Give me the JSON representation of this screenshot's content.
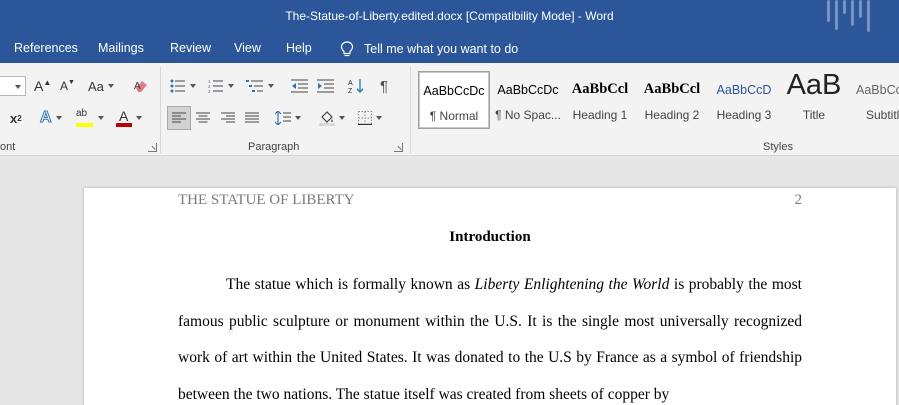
{
  "window": {
    "title": "The-Statue-of-Liberty.edited.docx [Compatibility Mode]  -  Word"
  },
  "tabs": [
    {
      "label": "References"
    },
    {
      "label": "Mailings"
    },
    {
      "label": "Review"
    },
    {
      "label": "View"
    },
    {
      "label": "Help"
    }
  ],
  "tell_me": {
    "label": "Tell me what you want to do"
  },
  "ribbon": {
    "groups": {
      "font": "ont",
      "paragraph": "Paragraph",
      "styles": "Styles"
    },
    "font": {
      "grow_font": "A",
      "shrink_font": "A",
      "change_case": "Aa",
      "superscript": "x",
      "superscript_mark": "2",
      "font_color_letter": "A",
      "highlight_letters": "ab",
      "text_effects_letter": "A"
    },
    "styles": [
      {
        "preview": "AaBbCcDc",
        "name": "¶ Normal",
        "selected": true
      },
      {
        "preview": "AaBbCcDc",
        "name": "¶ No Spac..."
      },
      {
        "preview": "AaBbCcl",
        "name": "Heading 1"
      },
      {
        "preview": "AaBbCcl",
        "name": "Heading 2"
      },
      {
        "preview": "AaBbCcD",
        "name": "Heading 3"
      },
      {
        "preview": "AaB",
        "name": "Title"
      },
      {
        "preview": "AaBbCc",
        "name": "Subtitle"
      }
    ]
  },
  "colors": {
    "ribbon_blue": "#2b579a",
    "font_color_underline": "#c00000",
    "highlight_underline": "#ffff00",
    "heading_blue": "#2f5496"
  },
  "document": {
    "running_head": "THE STATUE OF LIBERTY",
    "page_number": "2",
    "heading": "Introduction",
    "paragraph_part1": "The statue which is formally known as ",
    "paragraph_italic": "Liberty Enlightening the World",
    "paragraph_part2": " is probably the most famous public sculpture or monument within the U.S.  It is the single most universally recognized work of art within the United States. It was donated to the U.S by France as a symbol of friendship between the two nations. The statue itself was created from sheets of copper by"
  }
}
